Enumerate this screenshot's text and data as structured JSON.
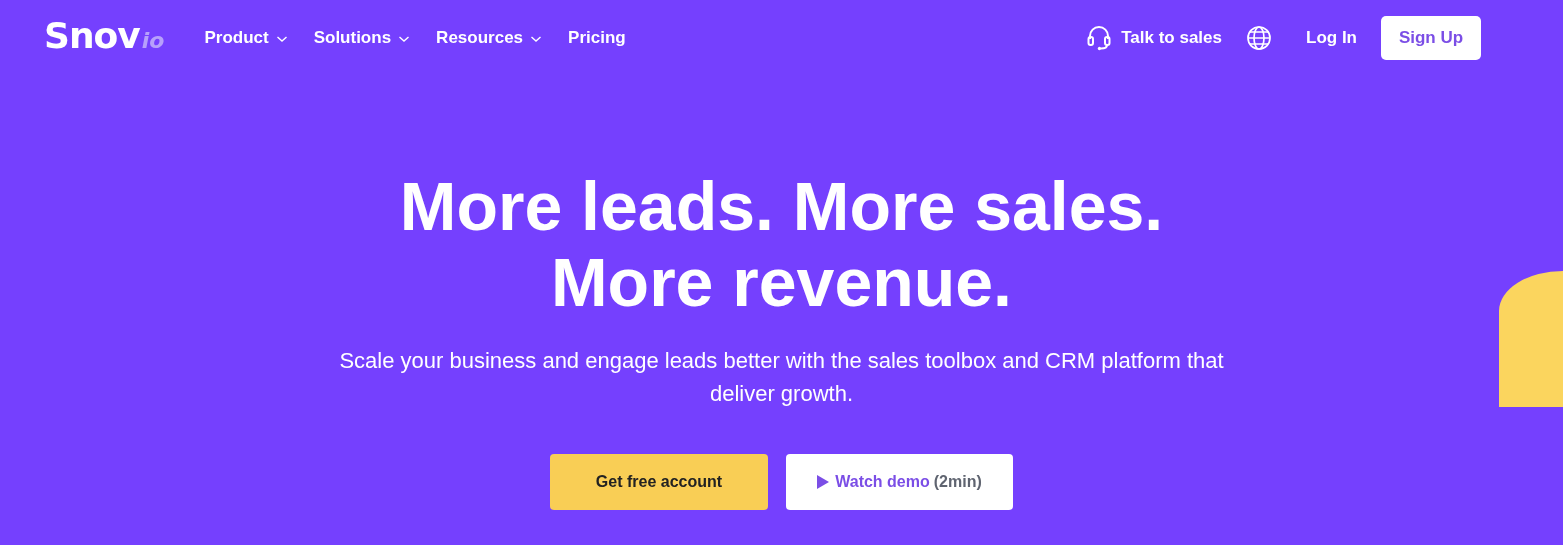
{
  "logo": {
    "main": "Snov",
    "suffix": "io"
  },
  "nav": [
    {
      "label": "Product",
      "dropdown": true
    },
    {
      "label": "Solutions",
      "dropdown": true
    },
    {
      "label": "Resources",
      "dropdown": true
    },
    {
      "label": "Pricing",
      "dropdown": false
    }
  ],
  "actions": {
    "sales": "Talk to sales",
    "login": "Log In",
    "signup": "Sign Up"
  },
  "hero": {
    "title_lines": [
      "More leads. More sales.",
      "More revenue."
    ],
    "subtitle": "Scale your business and engage leads better with the sales toolbox and CRM platform that deliver growth.",
    "primary": "Get free account",
    "demo": "Watch demo",
    "demo_length": "(2min)"
  }
}
